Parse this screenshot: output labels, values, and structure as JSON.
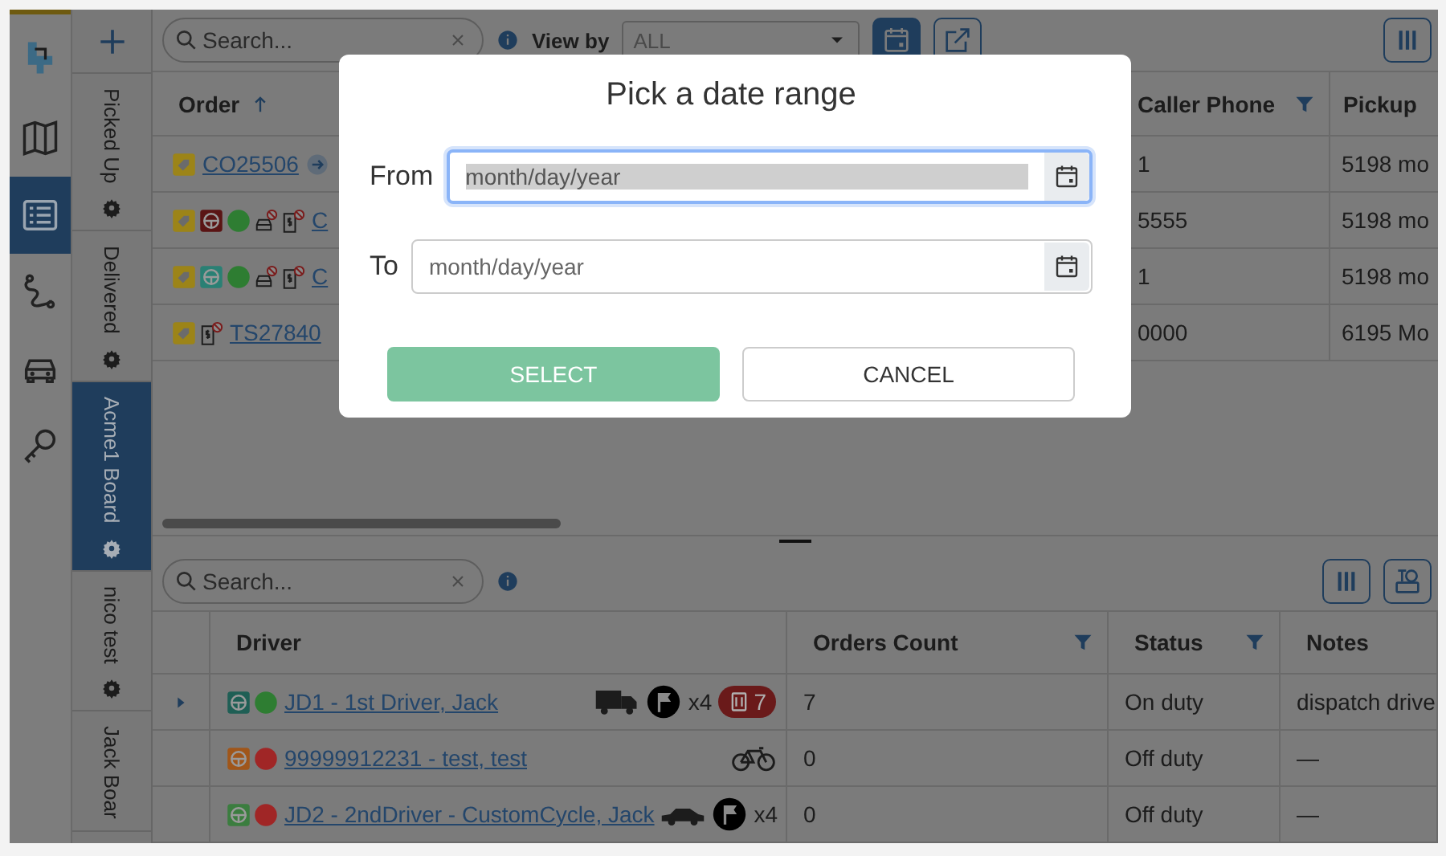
{
  "nav_rail": [
    {
      "kind": "logo",
      "selected": false
    },
    {
      "kind": "map",
      "selected": false
    },
    {
      "kind": "list",
      "selected": true
    },
    {
      "kind": "route",
      "selected": false
    },
    {
      "kind": "car",
      "selected": false
    },
    {
      "kind": "key",
      "selected": false
    }
  ],
  "boards": {
    "tabs": [
      {
        "label": "Picked Up",
        "selected": false,
        "settings": true
      },
      {
        "label": "Delivered",
        "selected": false,
        "settings": true
      },
      {
        "label": "Acme1 Board",
        "selected": true,
        "settings": true
      },
      {
        "label": "nico test",
        "selected": false,
        "settings": true
      },
      {
        "label": "Jack Boar",
        "selected": false,
        "settings": false
      }
    ]
  },
  "orders": {
    "search": {
      "placeholder": "Search..."
    },
    "view_by": {
      "label": "View by",
      "value": "ALL"
    },
    "columns": [
      {
        "label": "Order",
        "sorted": true,
        "filter": false
      },
      {
        "label": "Caller Phone",
        "sorted": false,
        "filter": true
      },
      {
        "label": "Pickup",
        "sorted": false,
        "filter": false
      }
    ],
    "rows": [
      {
        "icons": [
          {
            "kind": "tag"
          }
        ],
        "order": "CO25506",
        "goto": true,
        "caller_phone": "1",
        "pickup": "5198 mo"
      },
      {
        "icons": [
          {
            "kind": "tag"
          },
          {
            "kind": "driver",
            "color": "#5a1414"
          },
          {
            "kind": "dot",
            "color": "#2e7d32"
          },
          {
            "kind": "car-blocked"
          },
          {
            "kind": "invoice-blocked"
          }
        ],
        "order": "C",
        "goto": false,
        "caller_phone": "5555",
        "pickup": "5198 mo"
      },
      {
        "icons": [
          {
            "kind": "tag"
          },
          {
            "kind": "driver",
            "color": "#2a8074"
          },
          {
            "kind": "dot",
            "color": "#2e7d32"
          },
          {
            "kind": "car-blocked"
          },
          {
            "kind": "invoice-blocked"
          }
        ],
        "order": "C",
        "goto": false,
        "caller_phone": "1",
        "pickup": "5198 mo"
      },
      {
        "icons": [
          {
            "kind": "tag"
          },
          {
            "kind": "invoice-blocked"
          }
        ],
        "order": "TS27840",
        "goto": false,
        "caller_phone": "0000",
        "pickup": "6195 Mo"
      }
    ]
  },
  "drivers": {
    "search": {
      "placeholder": "Search..."
    },
    "columns": [
      {
        "label": "Driver",
        "filter": false
      },
      {
        "label": "Orders Count",
        "filter": true
      },
      {
        "label": "Status",
        "filter": true
      },
      {
        "label": "Notes",
        "filter": false
      }
    ],
    "rows": [
      {
        "expandable": true,
        "icons": [
          {
            "kind": "driver",
            "color": "#1f5f55"
          },
          {
            "kind": "dot",
            "color": "#2e7d32"
          }
        ],
        "name": "JD1 - 1st Driver, Jack",
        "vehicle": {
          "kind": "truck"
        },
        "flag": true,
        "count": "x4",
        "badge": "7",
        "orders_count": "7",
        "status": "On duty",
        "notes": "dispatch drive"
      },
      {
        "expandable": false,
        "icons": [
          {
            "kind": "driver",
            "color": "#a0561a"
          },
          {
            "kind": "dot",
            "color": "#a02626"
          }
        ],
        "name": "99999912231 - test, test",
        "vehicle": {
          "kind": "bicycle"
        },
        "flag": false,
        "orders_count": "0",
        "status": "Off duty",
        "notes": "—"
      },
      {
        "expandable": false,
        "icons": [
          {
            "kind": "driver",
            "color": "#3b7d3f"
          },
          {
            "kind": "dot",
            "color": "#a02626"
          }
        ],
        "name": "JD2 - 2ndDriver - CustomCycle, Jack",
        "vehicle": {
          "kind": "car"
        },
        "flag": true,
        "count": "x4",
        "orders_count": "0",
        "status": "Off duty",
        "notes": "—"
      }
    ]
  },
  "dialog": {
    "title": "Pick a date range",
    "fields": [
      {
        "label": "From",
        "placeholder": "month/day/year",
        "focused": true
      },
      {
        "label": "To",
        "placeholder": "month/day/year",
        "focused": false
      }
    ],
    "buttons": [
      {
        "label": "SELECT",
        "kind": "primary",
        "disabled": true
      },
      {
        "label": "CANCEL",
        "kind": "secondary",
        "disabled": false
      }
    ]
  }
}
